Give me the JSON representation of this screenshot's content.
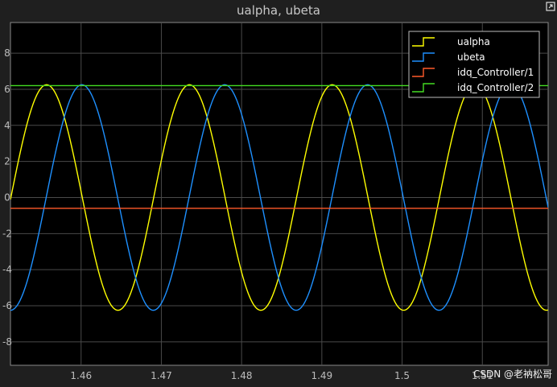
{
  "chart_data": {
    "type": "line",
    "title": "ualpha, ubeta",
    "xlim": [
      1.4512,
      1.5182
    ],
    "ylim": [
      -9.3,
      9.7
    ],
    "x_ticks": [
      1.46,
      1.47,
      1.48,
      1.49,
      1.5,
      1.51
    ],
    "x_tick_labels": [
      "1.46",
      "1.47",
      "1.48",
      "1.49",
      "1.5",
      "1.51"
    ],
    "y_ticks": [
      8,
      6,
      4,
      2,
      0,
      -2,
      -4,
      -6,
      -8
    ],
    "y_tick_labels": [
      "8",
      "6",
      "4",
      "2",
      "0",
      "-2",
      "-4",
      "-6",
      "-8"
    ],
    "grid": true,
    "legend_position": "top-right",
    "series": [
      {
        "name": "ualpha",
        "color": "#ffff00",
        "kind": "sine",
        "amplitude": 6.25,
        "period": 0.0178,
        "peak_x": 1.4557
      },
      {
        "name": "ubeta",
        "color": "#1e90ff",
        "kind": "sine",
        "amplitude": 6.25,
        "period": 0.0178,
        "peak_x": 1.4601
      },
      {
        "name": "idq_Controller/1",
        "color": "#ff5a2a",
        "kind": "constant",
        "value": -0.6
      },
      {
        "name": "idq_Controller/2",
        "color": "#44dd22",
        "kind": "constant",
        "value": 6.2
      }
    ]
  },
  "watermark": "CSDN @老衲松哥"
}
